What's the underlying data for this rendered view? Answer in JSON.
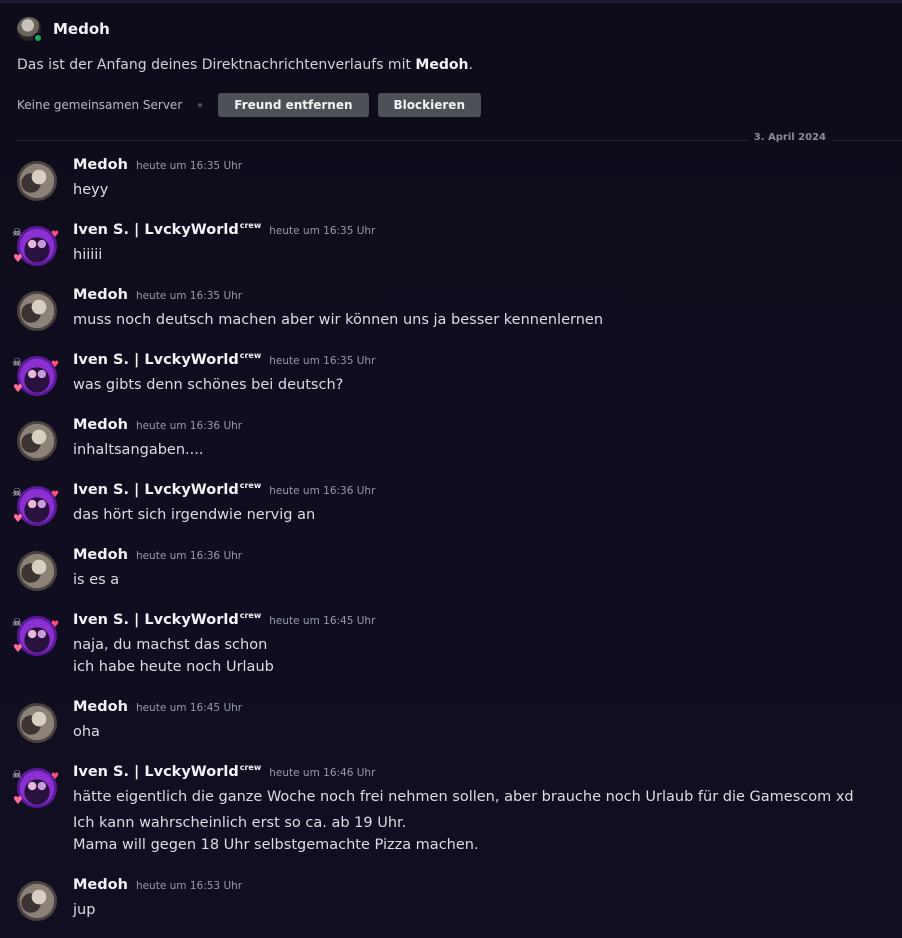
{
  "header": {
    "name": "Medoh",
    "avatar_icon": "user-avatar",
    "status": "online"
  },
  "intro": {
    "prefix": "Das ist der Anfang deines Direktnachrichtenverlaufs mit ",
    "name": "Medoh",
    "suffix": "."
  },
  "actions": {
    "no_server": "Keine gemeinsamen Server",
    "remove_friend": "Freund entfernen",
    "block": "Blockieren"
  },
  "date_divider": "3. April 2024",
  "messages": [
    {
      "author": "Medoh",
      "tag": "",
      "time": "heute um 16:35 Uhr",
      "lines": [
        "heyy"
      ]
    },
    {
      "author": "Iven S. | LvckyWorld",
      "tag": "crew",
      "time": "heute um 16:35 Uhr",
      "lines": [
        "hiiiii"
      ]
    },
    {
      "author": "Medoh",
      "tag": "",
      "time": "heute um 16:35 Uhr",
      "lines": [
        "muss noch deutsch machen aber wir können uns ja besser kennenlernen"
      ]
    },
    {
      "author": "Iven S. | LvckyWorld",
      "tag": "crew",
      "time": "heute um 16:35 Uhr",
      "lines": [
        "was gibts denn schönes bei deutsch?"
      ]
    },
    {
      "author": "Medoh",
      "tag": "",
      "time": "heute um 16:36 Uhr",
      "lines": [
        "inhaltsangaben...."
      ]
    },
    {
      "author": "Iven S. | LvckyWorld",
      "tag": "crew",
      "time": "heute um 16:36 Uhr",
      "lines": [
        "das hört sich irgendwie nervig an"
      ]
    },
    {
      "author": "Medoh",
      "tag": "",
      "time": "heute um 16:36 Uhr",
      "lines": [
        "is es a"
      ]
    },
    {
      "author": "Iven S. | LvckyWorld",
      "tag": "crew",
      "time": "heute um 16:45 Uhr",
      "lines": [
        "naja, du machst das schon",
        "ich habe heute noch Urlaub"
      ]
    },
    {
      "author": "Medoh",
      "tag": "",
      "time": "heute um 16:45 Uhr",
      "lines": [
        "oha"
      ]
    },
    {
      "author": "Iven S. | LvckyWorld",
      "tag": "crew",
      "time": "heute um 16:46 Uhr",
      "lines": [
        "hätte eigentlich die ganze Woche noch frei nehmen sollen, aber brauche noch Urlaub für die Gamescom xd",
        "Ich kann wahrscheinlich erst so ca. ab 19 Uhr.",
        "Mama will gegen 18 Uhr selbstgemachte Pizza machen."
      ]
    },
    {
      "author": "Medoh",
      "tag": "",
      "time": "heute um 16:53 Uhr",
      "lines": [
        "jup"
      ]
    }
  ]
}
